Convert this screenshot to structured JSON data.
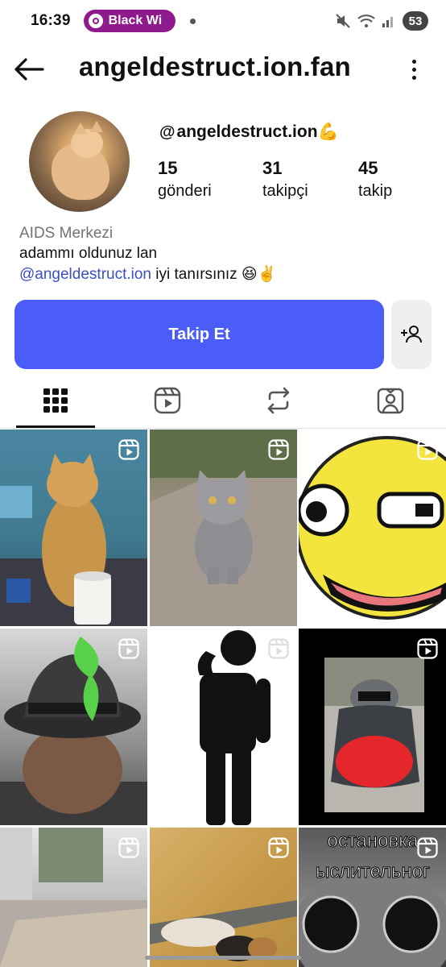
{
  "status_bar": {
    "time": "16:39",
    "media_pill_label": "Black Wi",
    "battery": "53",
    "accent_color": "#8e1a8e"
  },
  "header": {
    "title": "angeldestruct.ion.fan"
  },
  "profile": {
    "handle": "angeldestruct.ion",
    "handle_emoji": "💪",
    "stats": [
      {
        "value": "15",
        "label": "gönderi"
      },
      {
        "value": "31",
        "label": "takipçi"
      },
      {
        "value": "45",
        "label": "takip"
      }
    ],
    "category": "AIDS Merkezi",
    "bio_line1": "adammı oldunuz lan",
    "bio_link": "@angeldestruct.ion",
    "bio_line2_rest": " iyi tanırsınız 😆✌️"
  },
  "actions": {
    "follow_label": "Takip Et",
    "follow_color": "#4a5df9"
  },
  "tabs": [
    {
      "icon": "grid-icon",
      "active": true
    },
    {
      "icon": "reels-icon",
      "active": false
    },
    {
      "icon": "repost-icon",
      "active": false
    },
    {
      "icon": "tagged-icon",
      "active": false
    }
  ],
  "grid": {
    "posts": [
      {
        "subject": "cat standing",
        "is_reel": true
      },
      {
        "subject": "gray cat walking",
        "is_reel": true
      },
      {
        "subject": "yellow smiley face",
        "is_reel": true
      },
      {
        "subject": "cat in smoking hat",
        "is_reel": true
      },
      {
        "subject": "stick figure",
        "is_reel": true
      },
      {
        "subject": "cat in red cape",
        "is_reel": true
      },
      {
        "subject": "room floor",
        "is_reel": true
      },
      {
        "subject": "dog on plywood",
        "is_reel": true
      },
      {
        "subject": "cat with round glasses",
        "is_reel": true,
        "caption_top": "остановка",
        "caption_bottom": "ыслительног"
      }
    ]
  }
}
